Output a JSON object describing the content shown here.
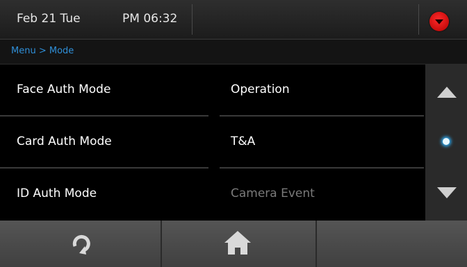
{
  "header": {
    "date": "Feb 21 Tue",
    "time": "PM 06:32",
    "menu_icon": "dropdown-arrow-red-icon"
  },
  "breadcrumb": {
    "text": "Menu > Mode"
  },
  "rows": [
    {
      "label": "Face Auth Mode",
      "value": "Operation"
    },
    {
      "label": "Card Auth Mode",
      "value": "T&A"
    },
    {
      "label": "ID Auth Mode",
      "value": "Camera Event"
    }
  ],
  "scroll": {
    "up_icon": "scroll-up-icon",
    "indicator_icon": "page-indicator-dot-icon",
    "down_icon": "scroll-down-icon"
  },
  "footer": {
    "back_icon": "refresh-back-icon",
    "home_icon": "home-icon"
  },
  "colors": {
    "accent": "#2f8fd8",
    "menu_red": "#e01010",
    "indicator": "#2fb4ff"
  }
}
